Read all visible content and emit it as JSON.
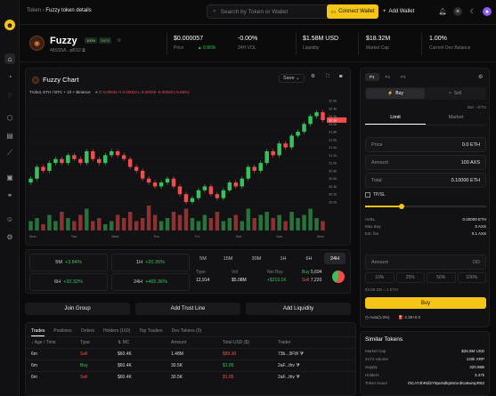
{
  "colors": {
    "accent": "#f5c518",
    "green": "#36c35b",
    "red": "#f04d4d",
    "bg": "#0b0b0c"
  },
  "header": {
    "crumb_root": "Token",
    "crumb_page": "Fuzzy token details",
    "search_placeholder": "Search by Token or Wallet",
    "connect_label": "Connect Wallet",
    "add_wallet_label": "Add Wallet"
  },
  "token": {
    "name": "Fuzzy",
    "tag1": "100%",
    "tag2": "SAFE",
    "address": "48SS5A...pBS2",
    "price": "$0.000057",
    "price_label": "Price",
    "price_change": "0.86%",
    "vol_change": "-0.00%",
    "vol_label": "24H VOL",
    "liquidity": "$1.58M USD",
    "liquidity_label": "Liquidity",
    "market_cap": "$18.32M",
    "market_cap_label": "Market Cap",
    "dev_balance": "1.00%",
    "dev_balance_label": "Current Dev Balance"
  },
  "chart": {
    "title": "Fuzzy Chart",
    "save_label": "Save",
    "pair": "Trobot, ETH / BTC + 1h + Binance",
    "ohlc": [
      "O 0.00031",
      "H 0.00033",
      "L 0.00028",
      "-0.00003",
      "(-6.68%)"
    ],
    "x_ticks": [
      "Mon",
      "Tue",
      "Wed",
      "Thu",
      "Fri",
      "Sat",
      "Sun",
      "Mon"
    ],
    "y_ticks": [
      "32.6k",
      "32.4k",
      "32.2k",
      "32.0k",
      "31.8k",
      "31.6k",
      "31.4k",
      "31.2k",
      "31.0k",
      "30.8k",
      "30.6k",
      "30.4k",
      "30.2k",
      "30.0k"
    ],
    "last_price": "32.1k"
  },
  "chart_data": {
    "type": "candlestick",
    "open": [
      30.5,
      30.6,
      30.9,
      30.8,
      31.0,
      31.1,
      31.0,
      31.2,
      31.1,
      31.0,
      31.3,
      31.1,
      31.0,
      31.2,
      31.3,
      31.2,
      31.1,
      30.9,
      30.8,
      30.6,
      30.5,
      30.4,
      30.5,
      30.6,
      30.4,
      30.2,
      30.0,
      30.1,
      30.3,
      30.4,
      30.2,
      30.1,
      30.3,
      30.5,
      30.4,
      30.6,
      30.9,
      30.8,
      31.0,
      31.3,
      31.2,
      31.5,
      31.4,
      31.7,
      31.8,
      32.0,
      32.2,
      32.3
    ],
    "close": [
      30.6,
      30.9,
      30.8,
      31.0,
      31.1,
      31.0,
      31.2,
      31.1,
      31.0,
      31.3,
      31.1,
      31.0,
      31.2,
      31.3,
      31.2,
      31.1,
      30.9,
      30.8,
      30.6,
      30.5,
      30.4,
      30.5,
      30.6,
      30.4,
      30.2,
      30.0,
      30.1,
      30.3,
      30.4,
      30.2,
      30.1,
      30.3,
      30.5,
      30.4,
      30.6,
      30.9,
      30.8,
      31.0,
      31.3,
      31.2,
      31.5,
      31.4,
      31.7,
      31.8,
      32.0,
      32.2,
      32.3,
      32.1
    ],
    "volumes": [
      3,
      4,
      2,
      5,
      3,
      6,
      4,
      3,
      5,
      7,
      3,
      4,
      2,
      3,
      5,
      4,
      6,
      3,
      4,
      8,
      5,
      3,
      4,
      6,
      5,
      7,
      4,
      3,
      5,
      4,
      6,
      3,
      4,
      5,
      3,
      7,
      4,
      5,
      6,
      4,
      5,
      3,
      6,
      4,
      5,
      7,
      4,
      3
    ]
  },
  "stats": {
    "m5": {
      "label": "5M",
      "value": "+3.84%"
    },
    "h1": {
      "label": "1H",
      "value": "+20.35%"
    },
    "h6": {
      "label": "6H",
      "value": "+32.32%"
    },
    "h24": {
      "label": "24H",
      "value": "+465.36%"
    },
    "timeframes": [
      "5M",
      "15M",
      "30M",
      "1H",
      "6H",
      "24H"
    ],
    "type_label": "Type",
    "type_value": "12,914",
    "vol_label": "Vol",
    "vol_value": "$5.08M",
    "netbuy_label": "Net Buy",
    "netbuy_value": "+$219.1K",
    "buy_label": "Buy",
    "buy_value": "5,694",
    "sell_label": "Sell",
    "sell_value": "7,220"
  },
  "actions": {
    "join": "Join Group",
    "trust": "Add Trust Line",
    "liquidity": "Add Liquidity"
  },
  "trades": {
    "tabs": [
      "Trades",
      "Positions",
      "Orders",
      "Holders (160)",
      "Top Traders",
      "Dev Tokens (0)"
    ],
    "headers": [
      "Age / Time",
      "Type",
      "MC",
      "Amount",
      "Total USD ($)",
      "Trader"
    ],
    "rows": [
      {
        "age": "6m",
        "type": "Sell",
        "mc": "$60.4K",
        "amount": "1.48M",
        "total": "$89.30",
        "trader": "73b...3FW"
      },
      {
        "age": "6m",
        "type": "Buy",
        "mc": "$60.4K",
        "amount": "30.5K",
        "total": "$1.85",
        "trader": "2aF...thv"
      },
      {
        "age": "6m",
        "type": "Sell",
        "mc": "$60.4K",
        "amount": "30.5K",
        "total": "$1.85",
        "trader": "2aF...thv"
      }
    ]
  },
  "order": {
    "presets": [
      "P1",
      "P2",
      "P3"
    ],
    "buy_label": "Buy",
    "sell_label": "Sell",
    "bal_label": "Bal: --ETH",
    "limit_label": "Limit",
    "market_label": "Market",
    "price_label": "Price",
    "price_value": "0.0 ETH",
    "amount_label": "Amount",
    "amount_value": "100 AXS",
    "total_label": "Total",
    "total_value": "0.10000 ETH",
    "tpsl_label": "TP/SL",
    "avbl_label": "AVBL",
    "avbl_value": "0.00000 ETH",
    "maxbuy_label": "Max Buy",
    "maxbuy_value": "0 AXS",
    "fee_label": "Est. fee",
    "fee_value": "0.1 AXS",
    "amount2_label": "Amount",
    "amount2_unit": "DD",
    "pcts": [
      "10%",
      "25%",
      "50%",
      "100%"
    ],
    "bal2_label": "83.89 DD = 1 ETH",
    "buy_btn": "Buy",
    "auto_label": "Auto(1.0%)",
    "gas_label": "2.38+0.0"
  },
  "similar": {
    "title": "Similar Tokens",
    "rows": [
      {
        "k": "Market Cap",
        "v": "$26.9M USD"
      },
      {
        "k": "24 hr volume",
        "v": "120k XRP"
      },
      {
        "k": "Supply",
        "v": "320.96B"
      },
      {
        "k": "Holders",
        "v": "3.47k"
      },
      {
        "k": "Token issuer",
        "v": "rhCAT4hRdi2Y9puNdkpMzxrdKa5wrspR62"
      }
    ]
  }
}
